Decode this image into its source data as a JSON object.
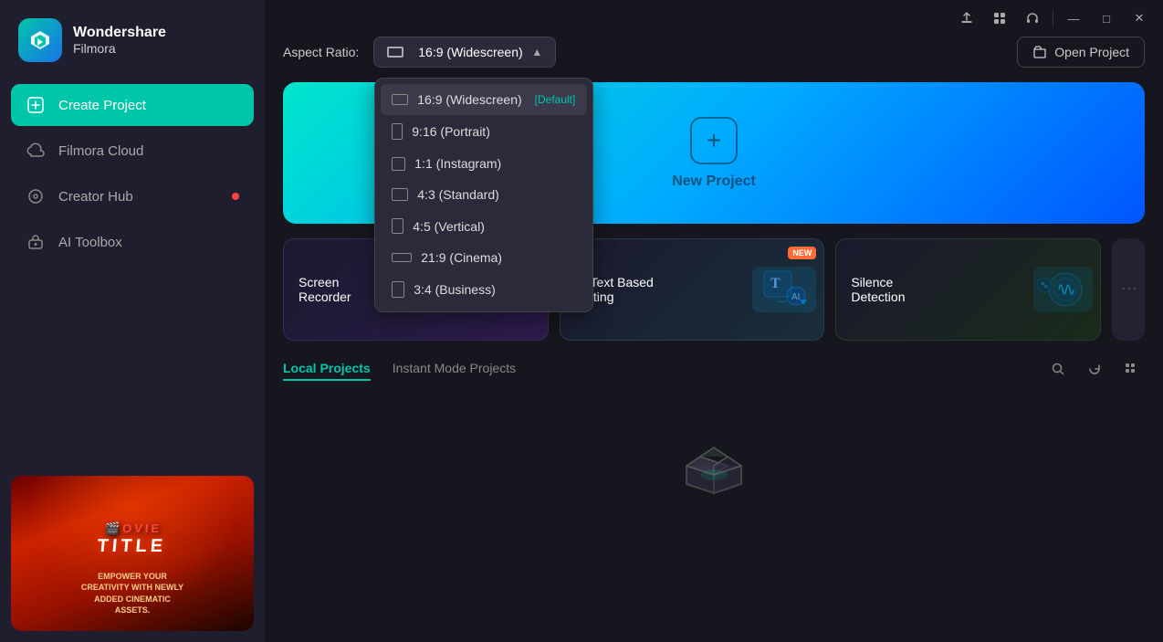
{
  "app": {
    "name": "Wondershare",
    "product": "Filmora",
    "logo_color1": "#00c6a9",
    "logo_color2": "#1a73e8"
  },
  "titlebar": {
    "upload_title": "Upload",
    "grid_title": "Grid view",
    "headset_title": "Support",
    "minimize_label": "Minimize",
    "maximize_label": "Maximize",
    "close_label": "Close"
  },
  "sidebar": {
    "create_project_label": "Create Project",
    "filmora_cloud_label": "Filmora Cloud",
    "creator_hub_label": "Creator Hub",
    "ai_toolbox_label": "AI Toolbox"
  },
  "aspect_ratio": {
    "label": "Aspect Ratio:",
    "selected": "16:9 (Widescreen)",
    "options": [
      {
        "value": "16:9 (Widescreen)",
        "tag": "[Default]",
        "type": "wide"
      },
      {
        "value": "9:16 (Portrait)",
        "tag": "",
        "type": "portrait"
      },
      {
        "value": "1:1 (Instagram)",
        "tag": "",
        "type": "square"
      },
      {
        "value": "4:3 (Standard)",
        "tag": "",
        "type": "standard"
      },
      {
        "value": "4:5 (Vertical)",
        "tag": "",
        "type": "vertical"
      },
      {
        "value": "21:9 (Cinema)",
        "tag": "",
        "type": "cinema"
      },
      {
        "value": "3:4 (Business)",
        "tag": "",
        "type": "business"
      }
    ]
  },
  "open_project": {
    "label": "Open Project"
  },
  "new_project": {
    "label": "New Project"
  },
  "feature_cards": [
    {
      "id": "screen-recorder",
      "label": "Screen Recorder",
      "new": false
    },
    {
      "id": "ai-text-editing",
      "label": "AI Text Based Editing",
      "new": true
    },
    {
      "id": "silence-detection",
      "label": "Silence Detection",
      "new": false
    }
  ],
  "projects": {
    "local_tab": "Local Projects",
    "instant_tab": "Instant Mode Projects",
    "active_tab": "local"
  },
  "icons": {
    "search": "🔍",
    "refresh": "↻",
    "grid": "⊞",
    "upload": "⬆",
    "headset": "🎧",
    "folder": "📁",
    "plus": "+",
    "more": "•••",
    "chevron_up": "▲",
    "chevron_down": "▾"
  }
}
